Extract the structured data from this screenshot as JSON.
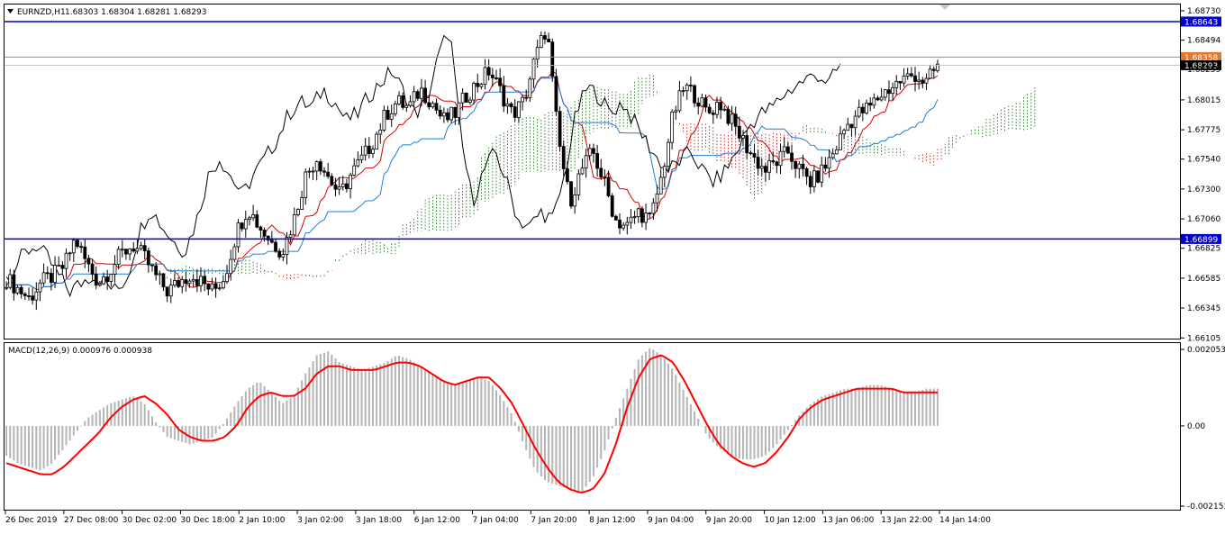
{
  "header": {
    "symbol": "EURNZD,H1",
    "ohlc": "1.68303 1.68304 1.68281 1.68293"
  },
  "macd_header": {
    "label": "MACD(12,26,9) 0.000976 0.000938"
  },
  "colors": {
    "background": "#ffffff",
    "candle": "#000000",
    "tenkan": "#d40000",
    "kijun": "#1e7fd6",
    "chikou": "#000000",
    "cloud_bull": "#006400",
    "cloud_bear": "#b40000",
    "level_line": "#0000c8",
    "bid_line": "#e07830",
    "macd_hist": "#b4b4b4",
    "macd_signal": "#ff0000"
  },
  "chart_data": [
    {
      "type": "candlestick",
      "symbol": "EURNZD",
      "timeframe": "H1",
      "ylim": [
        1.661,
        1.6878
      ],
      "yticks": [
        "1.68730",
        "1.68494",
        "1.68259",
        "1.68015",
        "1.67775",
        "1.67540",
        "1.67300",
        "1.67060",
        "1.66825",
        "1.66585",
        "1.66345",
        "1.66105"
      ],
      "xticks": [
        "26 Dec 2019",
        "27 Dec 08:00",
        "30 Dec 02:00",
        "30 Dec 18:00",
        "2 Jan 10:00",
        "3 Jan 02:00",
        "3 Jan 18:00",
        "6 Jan 12:00",
        "7 Jan 04:00",
        "7 Jan 20:00",
        "8 Jan 12:00",
        "9 Jan 04:00",
        "9 Jan 20:00",
        "10 Jan 12:00",
        "13 Jan 06:00",
        "13 Jan 22:00",
        "14 Jan 14:00"
      ],
      "close_path": [
        1.6658,
        1.665,
        1.6642,
        1.6655,
        1.666,
        1.6668,
        1.669,
        1.667,
        1.6655,
        1.6665,
        1.6678,
        1.6685,
        1.6675,
        1.666,
        1.6648,
        1.6655,
        1.6662,
        1.6655,
        1.6648,
        1.666,
        1.6695,
        1.6715,
        1.67,
        1.6688,
        1.668,
        1.6705,
        1.674,
        1.6755,
        1.674,
        1.6725,
        1.6742,
        1.6755,
        1.677,
        1.679,
        1.68,
        1.6795,
        1.681,
        1.68,
        1.6785,
        1.679,
        1.6805,
        1.6815,
        1.6825,
        1.6808,
        1.679,
        1.68,
        1.6835,
        1.686,
        1.677,
        1.672,
        1.6745,
        1.676,
        1.6735,
        1.6705,
        1.67,
        1.6712,
        1.6705,
        1.674,
        1.679,
        1.6812,
        1.6805,
        1.679,
        1.68,
        1.6785,
        1.677,
        1.6755,
        1.6745,
        1.6752,
        1.676,
        1.6745,
        1.6735,
        1.6745,
        1.676,
        1.678,
        1.679,
        1.6795,
        1.6805,
        1.6812,
        1.6818,
        1.6822,
        1.6815,
        1.6829
      ],
      "levels": [
        {
          "price": 1.68643,
          "label": "1.68643",
          "kind": "level"
        },
        {
          "price": 1.68358,
          "label": "1.68358",
          "kind": "bid"
        },
        {
          "price": 1.68293,
          "label": "1.68293",
          "kind": "last"
        },
        {
          "price": 1.66899,
          "label": "1.66899",
          "kind": "level"
        }
      ],
      "indicators": [
        "Ichimoku cloud",
        "Tenkan-sen",
        "Kijun-sen",
        "Chikou span"
      ]
    },
    {
      "type": "macd",
      "params": "12,26,9",
      "main": 0.000976,
      "signal_value": 0.000938,
      "ylim": [
        -0.002153,
        0.002053
      ],
      "yticks": [
        "0.002053",
        "0.00",
        "-0.002153"
      ],
      "histogram": [
        -0.0008,
        -0.001,
        -0.0011,
        -0.0012,
        -0.001,
        -0.0006,
        -0.0002,
        0.0002,
        0.0004,
        0.0006,
        0.0007,
        0.0008,
        0.0006,
        0.0001,
        -0.0003,
        -0.0004,
        -0.0005,
        -0.0004,
        -0.0003,
        0.0001,
        0.0006,
        0.001,
        0.0012,
        0.0009,
        0.0006,
        0.0008,
        0.0014,
        0.0019,
        0.002,
        0.0017,
        0.0016,
        0.0015,
        0.0016,
        0.0017,
        0.0019,
        0.0018,
        0.0016,
        0.0014,
        0.0012,
        0.0011,
        0.0012,
        0.0013,
        0.0012,
        0.0008,
        0.0003,
        -0.0005,
        -0.0012,
        -0.0015,
        -0.0016,
        -0.0017,
        -0.0018,
        -0.0014,
        -0.0007,
        0.0002,
        0.001,
        0.0018,
        0.0021,
        0.0019,
        0.0015,
        0.0009,
        0.0003,
        -0.0003,
        -0.0006,
        -0.0008,
        -0.0009,
        -0.0009,
        -0.0008,
        -0.0005,
        -0.0001,
        0.0003,
        0.0006,
        0.0008,
        0.0009,
        0.001,
        0.001,
        0.0011,
        0.0011,
        0.001,
        0.0009,
        0.0009,
        0.001,
        0.001
      ],
      "signal": [
        -0.001,
        -0.0011,
        -0.0012,
        -0.0013,
        -0.0013,
        -0.0011,
        -0.0008,
        -0.0005,
        -0.0002,
        0.0002,
        0.0005,
        0.0007,
        0.0008,
        0.0006,
        0.0003,
        -0.0001,
        -0.0003,
        -0.0004,
        -0.0004,
        -0.0003,
        0.0,
        0.0005,
        0.0008,
        0.0009,
        0.0008,
        0.0008,
        0.001,
        0.0014,
        0.0016,
        0.0016,
        0.0015,
        0.0015,
        0.0015,
        0.0016,
        0.0017,
        0.0017,
        0.0016,
        0.0014,
        0.0012,
        0.0011,
        0.0012,
        0.0013,
        0.0013,
        0.001,
        0.0006,
        0.0,
        -0.0006,
        -0.0011,
        -0.0015,
        -0.0017,
        -0.0018,
        -0.0017,
        -0.0013,
        -0.0005,
        0.0005,
        0.0013,
        0.0018,
        0.0019,
        0.0017,
        0.0012,
        0.0006,
        0.0,
        -0.0005,
        -0.0008,
        -0.001,
        -0.0011,
        -0.001,
        -0.0007,
        -0.0003,
        0.0002,
        0.0005,
        0.0007,
        0.0008,
        0.0009,
        0.001,
        0.001,
        0.001,
        0.001,
        0.0009,
        0.0009,
        0.0009,
        0.0009
      ]
    }
  ]
}
